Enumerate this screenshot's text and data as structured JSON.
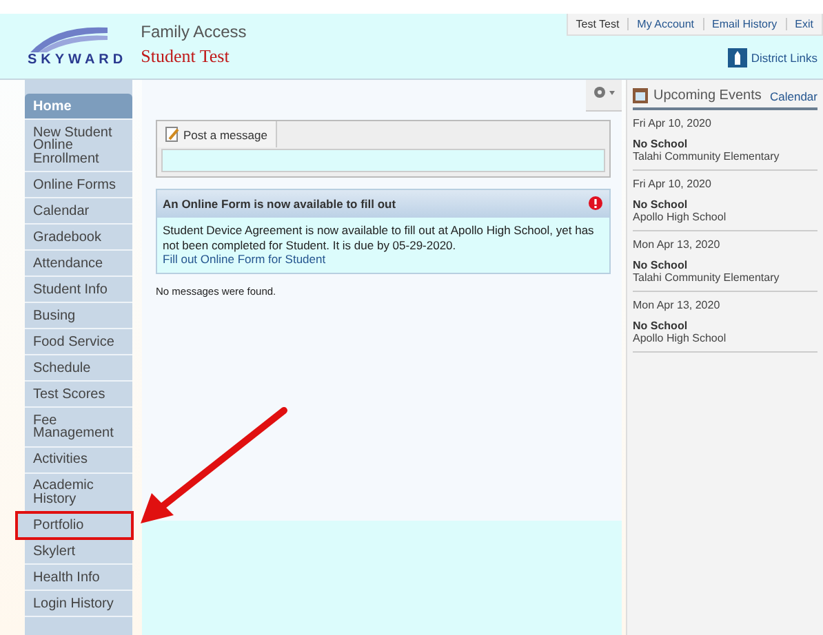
{
  "header": {
    "app_name": "Family Access",
    "logo": "SKYWARD",
    "student": "Student Test",
    "user_links": [
      "Test Test",
      "My Account",
      "Email History",
      "Exit"
    ],
    "district_links": "District Links"
  },
  "sidebar": {
    "items": [
      {
        "label": "Home",
        "selected": true,
        "highlighted": false
      },
      {
        "label": "New Student Online Enrollment",
        "selected": false,
        "highlighted": false
      },
      {
        "label": "Online Forms",
        "selected": false,
        "highlighted": false
      },
      {
        "label": "Calendar",
        "selected": false,
        "highlighted": false
      },
      {
        "label": "Gradebook",
        "selected": false,
        "highlighted": false
      },
      {
        "label": "Attendance",
        "selected": false,
        "highlighted": false
      },
      {
        "label": "Student Info",
        "selected": false,
        "highlighted": false
      },
      {
        "label": "Busing",
        "selected": false,
        "highlighted": false
      },
      {
        "label": "Food Service",
        "selected": false,
        "highlighted": false
      },
      {
        "label": "Schedule",
        "selected": false,
        "highlighted": false
      },
      {
        "label": "Test Scores",
        "selected": false,
        "highlighted": false
      },
      {
        "label": "Fee Management",
        "selected": false,
        "highlighted": false
      },
      {
        "label": "Activities",
        "selected": false,
        "highlighted": false
      },
      {
        "label": "Academic History",
        "selected": false,
        "highlighted": false
      },
      {
        "label": "Portfolio",
        "selected": false,
        "highlighted": true
      },
      {
        "label": "Skylert",
        "selected": false,
        "highlighted": false
      },
      {
        "label": "Health Info",
        "selected": false,
        "highlighted": false
      },
      {
        "label": "Login History",
        "selected": false,
        "highlighted": false
      }
    ]
  },
  "main": {
    "post_tab": "Post a message",
    "alert": {
      "title": "An Online Form is now available to fill out",
      "body": "Student Device Agreement is now available to fill out at Apollo High School, yet has not been completed for Student.  It is due by 05-29-2020.",
      "link": "Fill out Online Form for Student"
    },
    "no_messages": "No messages were found."
  },
  "events": {
    "title": "Upcoming Events",
    "calendar_link": "Calendar",
    "items": [
      {
        "date": "Fri Apr 10, 2020",
        "name": "No School",
        "place": "Talahi Community Elementary"
      },
      {
        "date": "Fri Apr 10, 2020",
        "name": "No School",
        "place": "Apollo High School"
      },
      {
        "date": "Mon Apr 13, 2020",
        "name": "No School",
        "place": "Talahi Community Elementary"
      },
      {
        "date": "Mon Apr 13, 2020",
        "name": "No School",
        "place": "Apollo High School"
      }
    ]
  }
}
